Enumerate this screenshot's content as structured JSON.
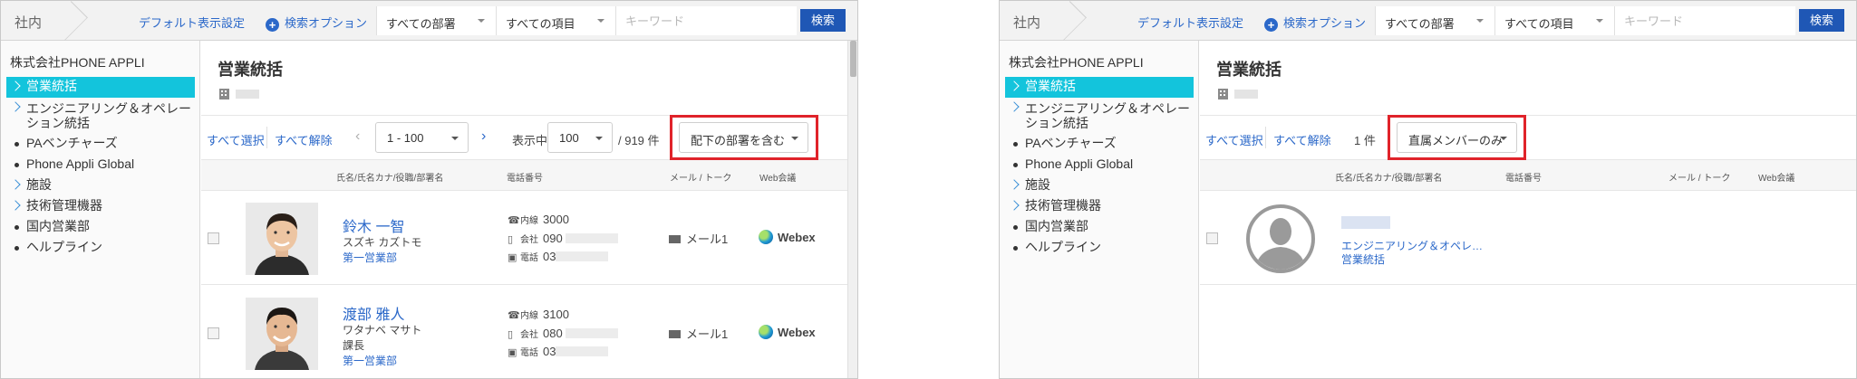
{
  "left": {
    "topbar": {
      "crumb": "社内",
      "default_view": "デフォルト表示設定",
      "search_options": "検索オプション",
      "dept_select": "すべての部署",
      "field_select": "すべての項目",
      "keyword_placeholder": "キーワード",
      "search_button": "検索"
    },
    "sidebar": {
      "org_name": "株式会社PHONE APPLI",
      "items": [
        {
          "label": "営業統括",
          "marker": "chevron",
          "active": true
        },
        {
          "label": "エンジニアリング＆オペレーション統括",
          "marker": "chevron"
        },
        {
          "label": "PAベンチャーズ",
          "marker": "dot"
        },
        {
          "label": "Phone Appli Global",
          "marker": "dot"
        },
        {
          "label": "施設",
          "marker": "chevron"
        },
        {
          "label": "技術管理機器",
          "marker": "chevron"
        },
        {
          "label": "国内営業部",
          "marker": "dot"
        },
        {
          "label": "ヘルプライン",
          "marker": "dot"
        }
      ]
    },
    "main": {
      "title": "営業統括",
      "select_all": "すべて選択",
      "deselect_all": "すべて解除",
      "range": "1 - 100",
      "showing_label": "表示中",
      "per_page": "100",
      "total": "/ 919 件",
      "scope_dropdown": "配下の部署を含む",
      "columns": {
        "name": "氏名/氏名カナ/役職/部署名",
        "phone": "電話番号",
        "mail": "メール / トーク",
        "web": "Web会議"
      },
      "rows": [
        {
          "name": "鈴木 一智",
          "kana": "スズキ カズトモ",
          "title": "",
          "dept": "第一営業部",
          "ext_label": "内線",
          "ext": "3000",
          "company_label": "会社",
          "company": "090",
          "phone_label": "電話",
          "phone": "03",
          "mail": "メール1",
          "web": "Webex"
        },
        {
          "name": "渡部 雅人",
          "kana": "ワタナベ マサト",
          "title": "課長",
          "dept": "第一営業部",
          "ext_label": "内線",
          "ext": "3100",
          "company_label": "会社",
          "company": "080",
          "phone_label": "電話",
          "phone": "03",
          "mail": "メール1",
          "web": "Webex"
        }
      ]
    }
  },
  "right": {
    "topbar": {
      "crumb": "社内",
      "default_view": "デフォルト表示設定",
      "search_options": "検索オプション",
      "dept_select": "すべての部署",
      "field_select": "すべての項目",
      "keyword_placeholder": "キーワード",
      "search_button": "検索"
    },
    "sidebar": {
      "org_name": "株式会社PHONE APPLI",
      "items": [
        {
          "label": "営業統括",
          "marker": "chevron",
          "active": true
        },
        {
          "label": "エンジニアリング＆オペレーション統括",
          "marker": "chevron"
        },
        {
          "label": "PAベンチャーズ",
          "marker": "dot"
        },
        {
          "label": "Phone Appli Global",
          "marker": "dot"
        },
        {
          "label": "施設",
          "marker": "chevron"
        },
        {
          "label": "技術管理機器",
          "marker": "chevron"
        },
        {
          "label": "国内営業部",
          "marker": "dot"
        },
        {
          "label": "ヘルプライン",
          "marker": "dot"
        }
      ]
    },
    "main": {
      "title": "営業統括",
      "select_all": "すべて選択",
      "deselect_all": "すべて解除",
      "count": "1 件",
      "scope_dropdown": "直属メンバーのみ",
      "columns": {
        "name": "氏名/氏名カナ/役職/部署名",
        "phone": "電話番号",
        "mail": "メール / トーク",
        "web": "Web会議"
      },
      "row": {
        "kana": "エンジニアリング＆オペレ…",
        "dept": "営業統括"
      }
    }
  },
  "colors": {
    "accent": "#2b68c9",
    "active_tree": "#13c4dc",
    "highlight": "#e0232a",
    "search_button": "#1f57b5"
  }
}
